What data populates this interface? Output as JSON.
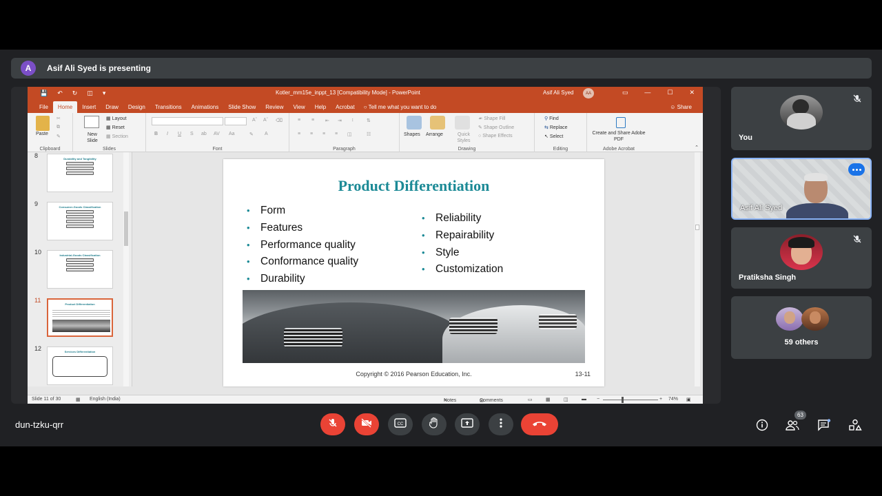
{
  "banner": {
    "avatar_letter": "A",
    "text": "Asif Ali Syed is presenting"
  },
  "powerpoint": {
    "doc_title": "Kotler_mm15e_inppt_13 [Compatibility Mode] - PowerPoint",
    "user_name": "Asif Ali Syed",
    "user_initials": "AA",
    "accent_color": "#c34a24",
    "menu": [
      "File",
      "Home",
      "Insert",
      "Draw",
      "Design",
      "Transitions",
      "Animations",
      "Slide Show",
      "Review",
      "View",
      "Help",
      "Acrobat"
    ],
    "active_menu": "Home",
    "tell_me": "Tell me what you want to do",
    "share": "Share",
    "ribbon": {
      "paste": "Paste",
      "new_slide": "New Slide",
      "layout": "Layout",
      "reset": "Reset",
      "section": "Section",
      "shapes": "Shapes",
      "arrange": "Arrange",
      "quick_styles": "Quick Styles",
      "shape_fill": "Shape Fill",
      "shape_outline": "Shape Outline",
      "shape_effects": "Shape Effects",
      "find": "Find",
      "replace": "Replace",
      "select": "Select",
      "create_share": "Create and Share Adobe PDF",
      "groups": [
        "Clipboard",
        "Slides",
        "Font",
        "Paragraph",
        "Drawing",
        "Editing",
        "Adobe Acrobat"
      ]
    },
    "thumbnails": [
      {
        "num": "8",
        "title": "Durability and Tangibility",
        "selected": false
      },
      {
        "num": "9",
        "title": "Consumer-Goods Classification",
        "selected": false
      },
      {
        "num": "10",
        "title": "Industrial-Goods Classification",
        "selected": false
      },
      {
        "num": "11",
        "title": "Product Differentiation",
        "selected": true
      },
      {
        "num": "12",
        "title": "Services Differentiation",
        "selected": false
      }
    ],
    "slide": {
      "title": "Product Differentiation",
      "left_bullets": [
        "Form",
        "Features",
        "Performance quality",
        "Conformance quality",
        "Durability"
      ],
      "right_bullets": [
        "Reliability",
        "Repairability",
        "Style",
        "Customization"
      ],
      "copyright": "Copyright © 2016 Pearson Education, Inc.",
      "page_number": "13-11",
      "title_color": "#1c8a96"
    },
    "status": {
      "slide_info": "Slide 11 of 30",
      "language": "English (India)",
      "notes": "Notes",
      "comments": "Comments",
      "zoom": "74%"
    }
  },
  "participants": [
    {
      "name": "You",
      "muted": true
    },
    {
      "name": "Asif Ali Syed",
      "speaking": true
    },
    {
      "name": "Pratiksha Singh",
      "muted": true
    },
    {
      "name": "59 others"
    }
  ],
  "meeting": {
    "code": "dun-tzku-qrr",
    "participant_count": "63",
    "end_color": "#ea4335"
  }
}
